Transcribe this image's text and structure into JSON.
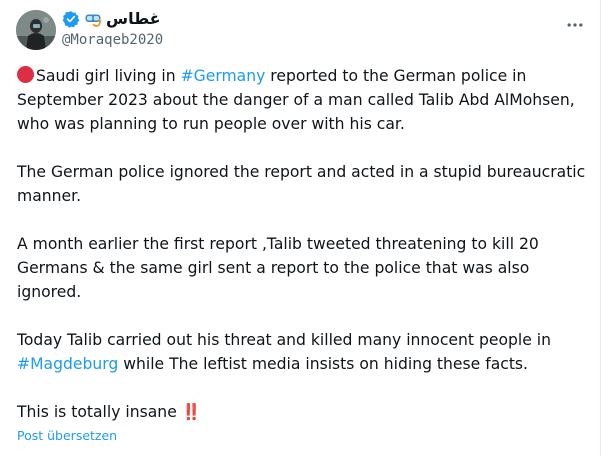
{
  "author": {
    "display_name": "غطاس",
    "handle": "@Moraqeb2020",
    "avatar_icon": "diver-avatar",
    "mask_icon": "diving-mask-icon",
    "verified_icon": "verified-badge-icon",
    "verified_color": "#1d9bf0"
  },
  "more_icon": "more-horizontal-icon",
  "tweet": {
    "p1_before": "Saudi girl living in ",
    "p1_hashtag": "#Germany",
    "p1_after": " reported to the German police in September 2023 about the danger of a man called Talib Abd AlMohsen, who was planning to run people over with his car.",
    "p2": "The German police ignored the report and acted in a stupid bureaucratic manner.",
    "p3": "A month earlier the first report ,Talib tweeted threatening to kill 20 Germans & the same girl sent a report to the police that was also ignored.",
    "p4_before": "Today Talib carried out his threat and killed many innocent people in ",
    "p4_hashtag": "#Magdeburg",
    "p4_after": " while The leftist media insists on hiding these facts.",
    "p5": "This is totally insane ",
    "p5_emoji": "‼️",
    "red_circle_icon": "red-circle-emoji",
    "hashtag_color": "#1d9bf0"
  },
  "translate_label": "Post übersetzen"
}
